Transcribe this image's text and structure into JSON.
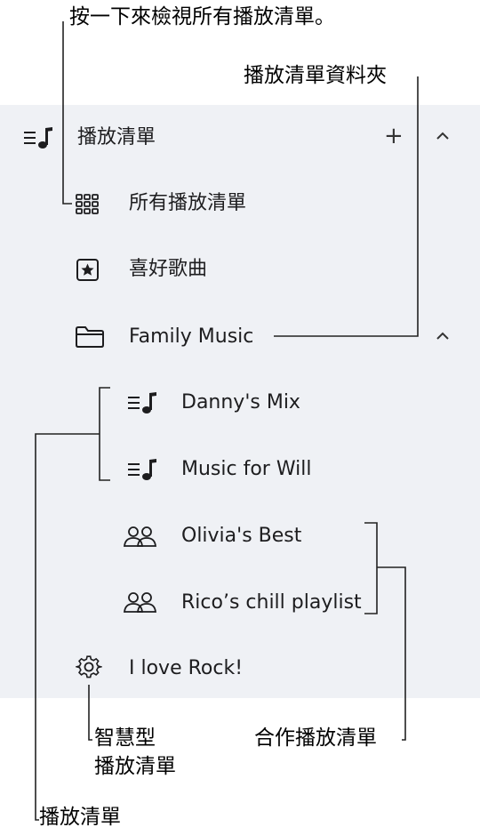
{
  "callouts": {
    "all_playlists": "按一下來檢視所有播放清單。",
    "playlist_folder": "播放清單資料夾",
    "smart_playlist_line1": "智慧型",
    "smart_playlist_line2": "播放清單",
    "collab_playlist": "合作播放清單",
    "playlists": "播放清單"
  },
  "sidebar": {
    "section_title": "播放清單",
    "add_symbol": "+",
    "collapse_symbol": "^",
    "items": [
      {
        "label": "所有播放清單",
        "icon": "grid-icon"
      },
      {
        "label": "喜好歌曲",
        "icon": "star-icon"
      },
      {
        "label": "Family Music",
        "icon": "folder-icon"
      },
      {
        "label": "Danny's Mix",
        "icon": "playlist-icon"
      },
      {
        "label": "Music for Will",
        "icon": "playlist-icon"
      },
      {
        "label": "Olivia's Best",
        "icon": "people-icon"
      },
      {
        "label": "Rico’s chill playlist",
        "icon": "people-icon"
      },
      {
        "label": "I love Rock!",
        "icon": "gear-icon"
      }
    ]
  }
}
